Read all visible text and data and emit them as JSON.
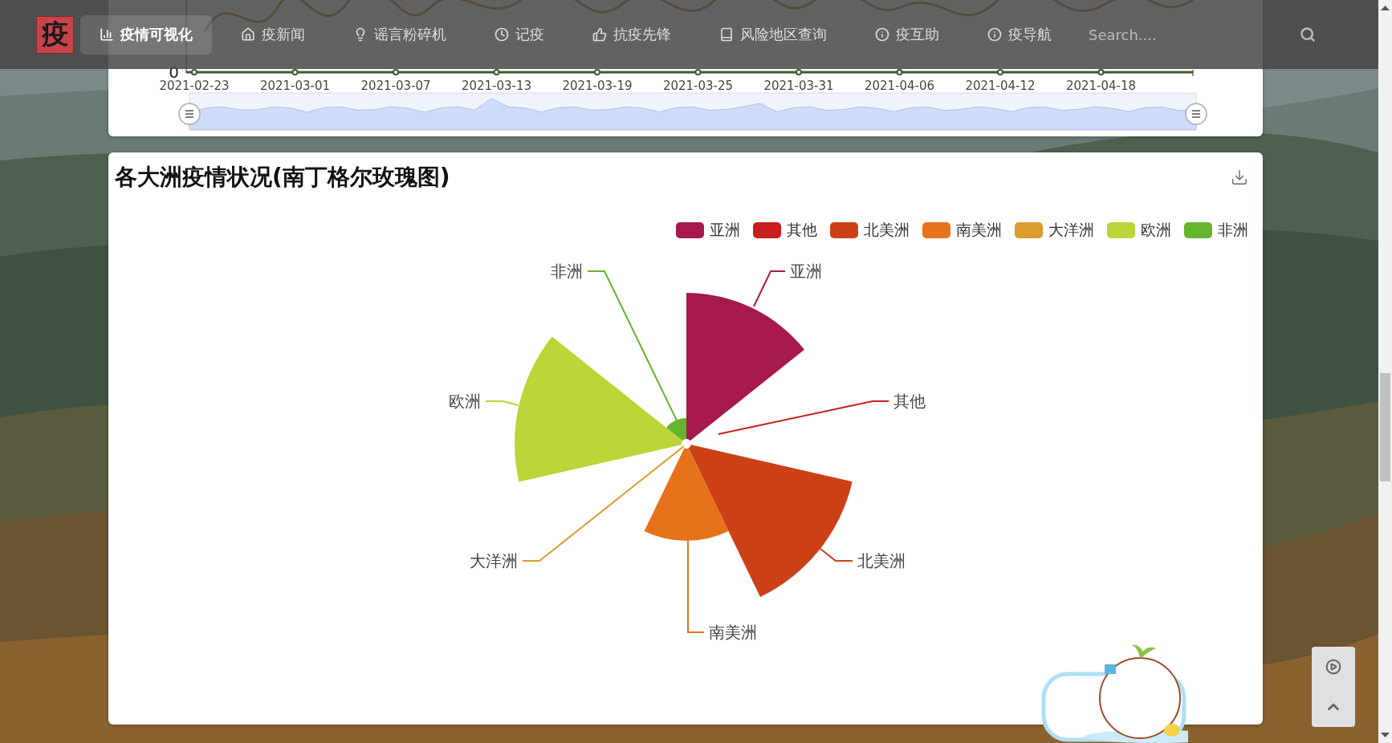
{
  "navbar": {
    "logo": "疫",
    "items": [
      {
        "label": "疫情可视化",
        "selected": true
      },
      {
        "label": "疫新闻",
        "selected": false
      },
      {
        "label": "谣言粉碎机",
        "selected": false
      },
      {
        "label": "记疫",
        "selected": false
      },
      {
        "label": "抗疫先锋",
        "selected": false
      },
      {
        "label": "风险地区查询",
        "selected": false
      },
      {
        "label": "疫互助",
        "selected": false
      },
      {
        "label": "疫导航",
        "selected": false
      }
    ],
    "search": {
      "placeholder": "Search...."
    }
  },
  "trend_chart": {
    "y_labels": [
      "0"
    ],
    "zoom_slider": {
      "level": 1
    },
    "x_labels": [
      "2021-02-23",
      "2021-03-01",
      "2021-03-07",
      "2021-03-13",
      "2021-03-19",
      "2021-03-25",
      "2021-03-31",
      "2021-04-06",
      "2021-04-12",
      "2021-04-18"
    ]
  },
  "rose_chart": {
    "title": "各大洲疫情状况(南丁格尔玫瑰图)",
    "legend": [
      {
        "label": "亚洲",
        "color": "#a5194d"
      },
      {
        "label": "其他",
        "color": "#c91e1e"
      },
      {
        "label": "北美洲",
        "color": "#cc4018"
      },
      {
        "label": "南美洲",
        "color": "#e6731c"
      },
      {
        "label": "大洋洲",
        "color": "#dc9c2e"
      },
      {
        "label": "欧洲",
        "color": "#bcd437"
      },
      {
        "label": "非洲",
        "color": "#64b42d"
      }
    ],
    "slice_labels": [
      {
        "label": "亚洲",
        "color": "#a5194d"
      },
      {
        "label": "其他",
        "color": "#c91e1e"
      },
      {
        "label": "北美洲",
        "color": "#cc4018"
      },
      {
        "label": "南美洲",
        "color": "#e6731c"
      },
      {
        "label": "大洋洲",
        "color": "#dc9c2e"
      },
      {
        "label": "欧洲",
        "color": "#bcd437"
      },
      {
        "label": "非洲",
        "color": "#64b42d"
      }
    ]
  }
}
